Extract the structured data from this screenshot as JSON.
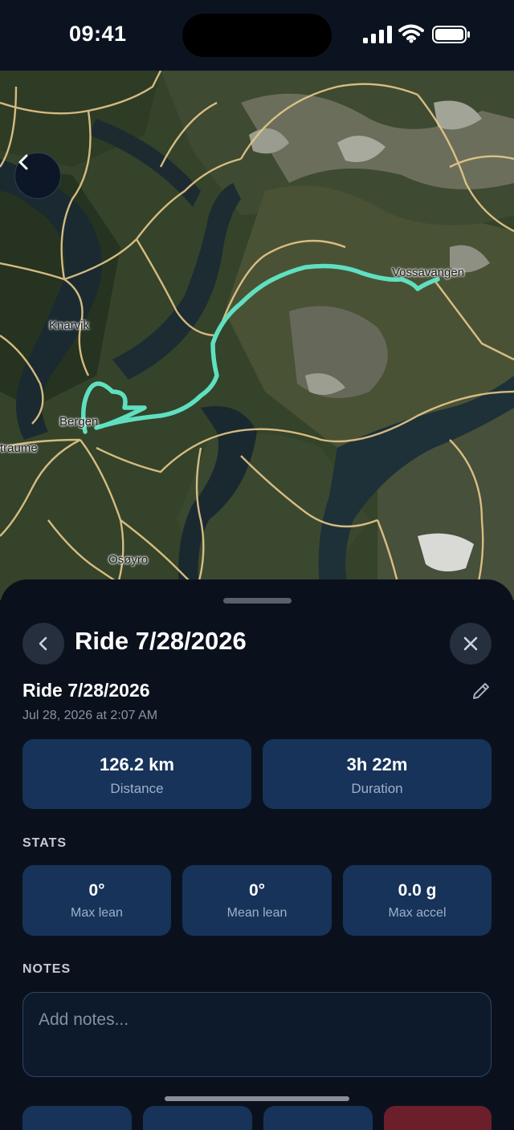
{
  "status_bar": {
    "time": "09:41"
  },
  "map": {
    "labels": {
      "knarvik": "Knarvik",
      "vossavangen": "Vossavangen",
      "bergen": "Bergen",
      "straume": "traume",
      "osoyro": "Osøyro"
    },
    "route_color": "#5fe0c0",
    "back_icon": "chevron-left-icon"
  },
  "sheet": {
    "title": "Ride 7/28/2026",
    "ride_name": "Ride 7/28/2026",
    "ride_date": "Jul 28, 2026 at 2:07 AM",
    "summary": [
      {
        "value": "126.2 km",
        "label": "Distance"
      },
      {
        "value": "3h 22m",
        "label": "Duration"
      }
    ],
    "stats_heading": "STATS",
    "stats": [
      {
        "value": "0°",
        "label": "Max lean"
      },
      {
        "value": "0°",
        "label": "Mean lean"
      },
      {
        "value": "0.0 g",
        "label": "Max accel"
      }
    ],
    "notes_heading": "NOTES",
    "notes_placeholder": "Add notes...",
    "accent_color": "#17335a",
    "danger_color": "#6a1f2a"
  }
}
